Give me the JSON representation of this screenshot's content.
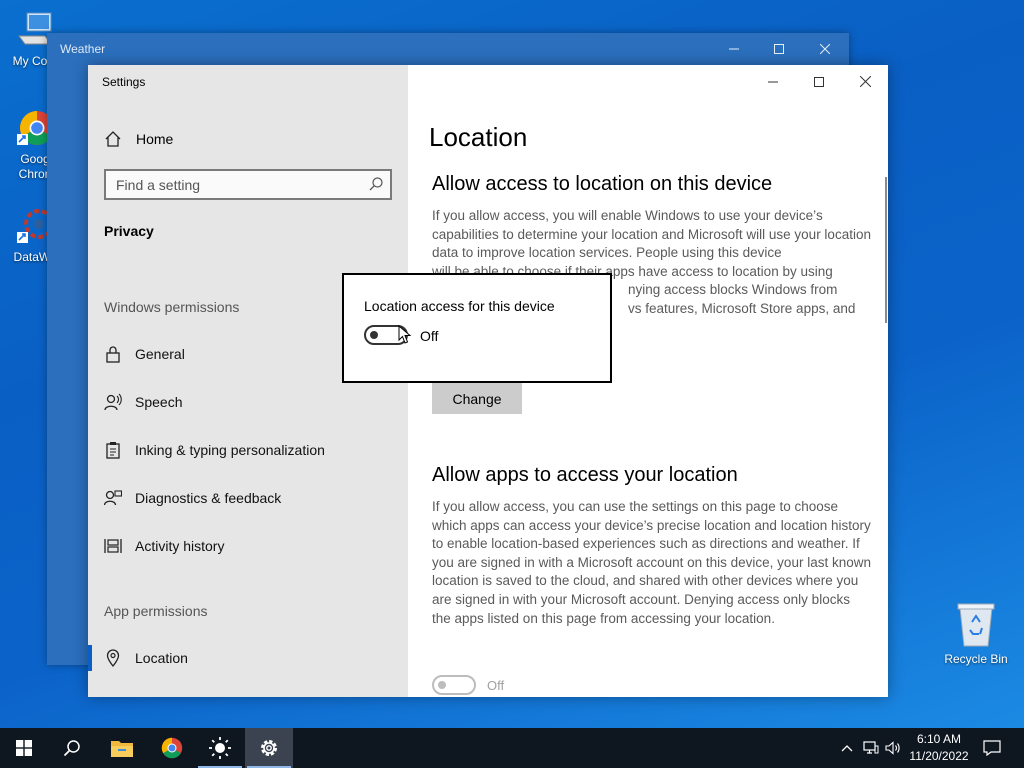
{
  "desktop": {
    "icons": [
      {
        "label": "My Com"
      },
      {
        "label": "Goog",
        "label2": "Chron"
      },
      {
        "label": "DataWa"
      }
    ],
    "recycle_bin": "Recycle Bin"
  },
  "weather_window": {
    "title": "Weather"
  },
  "settings": {
    "title": "Settings",
    "home": "Home",
    "search_placeholder": "Find a setting",
    "section": "Privacy",
    "windows_permissions": "Windows permissions",
    "windows_items": [
      {
        "label": "General",
        "icon": "lock-icon"
      },
      {
        "label": "Speech",
        "icon": "speech-icon"
      },
      {
        "label": "Inking & typing personalization",
        "icon": "clipboard-icon"
      },
      {
        "label": "Diagnostics & feedback",
        "icon": "feedback-icon"
      },
      {
        "label": "Activity history",
        "icon": "timeline-icon"
      }
    ],
    "app_permissions": "App permissions",
    "app_items": [
      {
        "label": "Location",
        "icon": "location-icon",
        "selected": true
      }
    ],
    "content": {
      "title": "Location",
      "device_heading": "Allow access to location on this device",
      "device_para_visible_before": "If you allow access, you will enable Windows to use your device’s capabilities to determine your location and Microsoft will use your location data to improve location services. People using this device",
      "device_para_partial_line1": "will be able to choose if their apps have access to location by using",
      "device_para_partial_line2": "nying access blocks Windows from",
      "device_para_partial_line3": "vs features, Microsoft Store apps, and",
      "change_button": "Change",
      "apps_heading": "Allow apps to access your location",
      "apps_para": "If you allow access, you can use the settings on this page to choose which apps can access your device’s precise location and location history to enable location-based experiences such as directions and weather. If you are signed in with a Microsoft account on this device, your last known location is saved to the cloud, and shared with other devices where you are signed in with your Microsoft account. Denying access only blocks the apps listed on this page from accessing your location.",
      "apps_toggle_state": "Off"
    },
    "popup": {
      "label": "Location access for this device",
      "state": "Off"
    }
  },
  "taskbar": {
    "time": "6:10 AM",
    "date": "11/20/2022"
  }
}
